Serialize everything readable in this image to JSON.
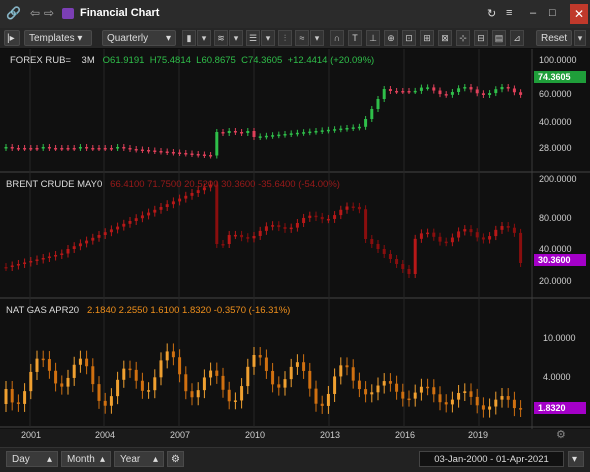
{
  "titlebar": {
    "title": "Financial Chart",
    "icons": [
      "link-icon",
      "back-arrow-icon",
      "forward-arrow-icon",
      "chart-app-icon",
      "refresh-icon",
      "menu-icon",
      "minimize-icon",
      "maximize-icon",
      "close-icon"
    ]
  },
  "toolbar": {
    "templates_label": "Templates",
    "period_label": "Quarterly",
    "reset_label": "Reset"
  },
  "panes": [
    {
      "name": "forex",
      "label_parts": {
        "symbol": "FOREX RUB=",
        "period": "3M",
        "o": "O61.9191",
        "h": "H75.4814",
        "l": "L60.8675",
        "c": "C74.3605",
        "chg": "+12.4414 (+20.09%)"
      },
      "axis_labels": [
        "100.0000",
        "60.0000",
        "40.0000",
        "28.0000"
      ],
      "last_price": "74.3605",
      "last_color": "#1f9e3a"
    },
    {
      "name": "brent",
      "label_parts": {
        "symbol": "BRENT CRUDE MAY0",
        "values": "66.4100  71.7500  20.5200  30.3600  -35.6400 (-54.00%)"
      },
      "axis_labels": [
        "200.0000",
        "80.0000",
        "40.0000",
        "20.0000"
      ],
      "last_price": "30.3600",
      "last_color": "#a400c8"
    },
    {
      "name": "natgas",
      "label_parts": {
        "symbol": "NAT GAS APR20",
        "values": "2.1840   2.2550   1.6100   1.8320   -0.3570 (-16.31%)"
      },
      "axis_labels": [
        "10.0000",
        "4.0000"
      ],
      "last_price": "1.8320",
      "last_color": "#a400c8"
    }
  ],
  "x_axis": [
    "2001",
    "2004",
    "2007",
    "2010",
    "2013",
    "2016",
    "2019"
  ],
  "bottombar": {
    "day_label": "Day",
    "month_label": "Month",
    "year_label": "Year",
    "date_range": "03-Jan-2000  -  01-Apr-2021"
  },
  "colors": {
    "up": "#2fbf4a",
    "down": "#e0405a",
    "brent": "#b01010",
    "gas": "#f0901c",
    "accent": "#a400c8"
  }
}
